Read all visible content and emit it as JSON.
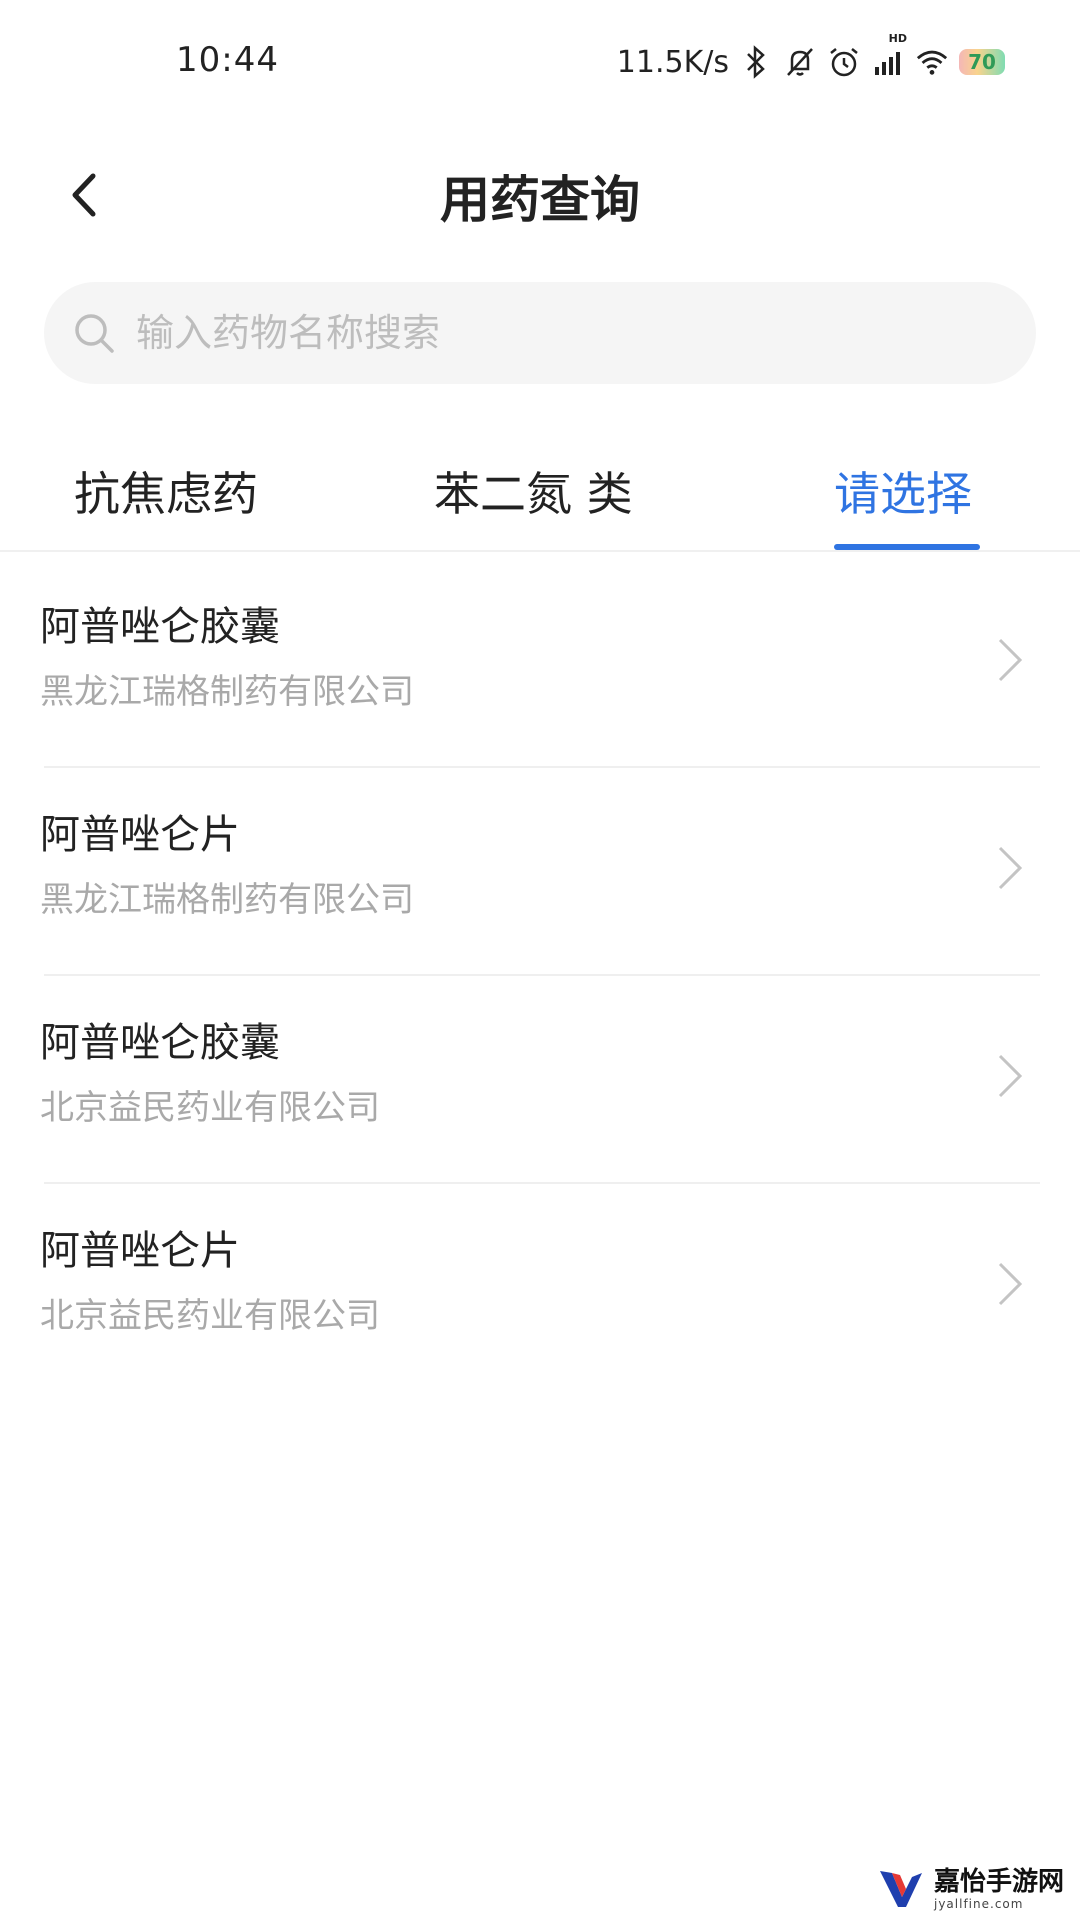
{
  "status_bar": {
    "time": "10:44",
    "net_speed": "11.5K/s",
    "icons": [
      "bluetooth-icon",
      "mute-icon",
      "alarm-icon",
      "signal-icon",
      "wifi-icon"
    ],
    "hd_label": "HD",
    "battery": "70"
  },
  "header": {
    "title": "用药查询",
    "back_icon": "chevron-left-icon"
  },
  "search": {
    "placeholder": "输入药物名称搜索",
    "icon": "search-icon"
  },
  "tabs": [
    {
      "label": "抗焦虑药",
      "active": false
    },
    {
      "label": "苯二氮 类",
      "active": false
    },
    {
      "label": "请选择",
      "active": true
    }
  ],
  "accent_color": "#2f74e2",
  "drugs": [
    {
      "name": "阿普唑仑胶囊",
      "company": "黑龙江瑞格制药有限公司"
    },
    {
      "name": "阿普唑仑片",
      "company": "黑龙江瑞格制药有限公司"
    },
    {
      "name": "阿普唑仑胶囊",
      "company": "北京益民药业有限公司"
    },
    {
      "name": "阿普唑仑片",
      "company": "北京益民药业有限公司"
    }
  ],
  "watermark": {
    "title": "嘉怡手游网",
    "url": "jyallfine.com"
  }
}
